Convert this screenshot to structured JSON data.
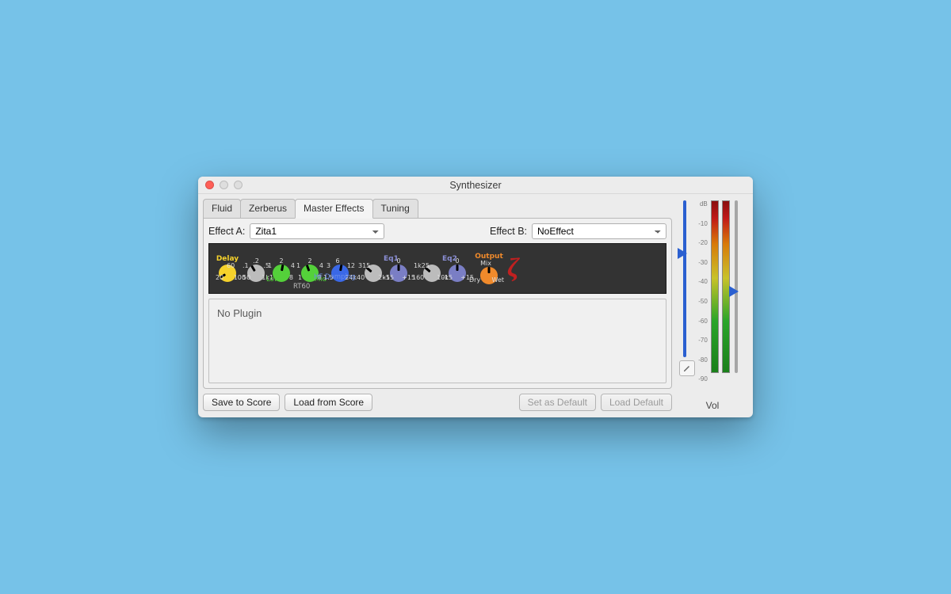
{
  "window": {
    "title": "Synthesizer"
  },
  "tabs": [
    "Fluid",
    "Zerberus",
    "Master Effects",
    "Tuning"
  ],
  "active_tab": 2,
  "effects": {
    "a_label": "Effect A:",
    "a_value": "Zita1",
    "b_label": "Effect B:",
    "b_value": "NoEffect"
  },
  "zita": {
    "sections": {
      "delay": {
        "title": "Delay",
        "color": "#f6d22b",
        "ticks": {
          "tl1": "60",
          "bl1": "20",
          "br1": "100"
        }
      },
      "xover": {
        "ticks": {
          "t": ".2",
          "tl": ".1",
          "tr": ".5",
          "bl": "50",
          "br": "1k"
        }
      },
      "low": {
        "title": "Low",
        "ticks": {
          "t": "2",
          "tl": "1",
          "tr": "4",
          "bl": "1",
          "br": "8"
        }
      },
      "mid": {
        "title": "Mid",
        "ticks": {
          "t": "2",
          "tl": "1",
          "tr": "4",
          "bl": "1",
          "br": "8"
        }
      },
      "hf": {
        "title": "HF Damping",
        "ticks": {
          "t": "6",
          "tl": "3",
          "tr": "12",
          "bl": "1.5",
          "br": "24k"
        }
      },
      "eq1f": {
        "title": "Eq1",
        "ticks": {
          "t": "315",
          "bl": "40",
          "br": "2k5"
        }
      },
      "eq1g": {
        "ticks": {
          "t": "0",
          "bl": "-15",
          "br": "+15"
        }
      },
      "eq2f": {
        "title": "Eq2",
        "ticks": {
          "t": "1k25",
          "bl": "160",
          "br": "10k"
        }
      },
      "eq2g": {
        "ticks": {
          "t": "0",
          "bl": "-15",
          "br": "+15"
        }
      },
      "mix": {
        "title": "Output",
        "subtitle": "Mix",
        "ticks": {
          "bl": "Dry",
          "br": "Wet"
        }
      }
    },
    "rt60_label": "RT60",
    "zeta": "ζ"
  },
  "no_plugin": "No Plugin",
  "buttons": {
    "save": "Save to Score",
    "load": "Load from Score",
    "set_default": "Set as Default",
    "load_default": "Load Default"
  },
  "meter": {
    "scale": [
      "dB",
      "-10",
      "-20",
      "-30",
      "-40",
      "-50",
      "-60",
      "-70",
      "-80",
      "-90"
    ],
    "vol_label": "Vol"
  }
}
